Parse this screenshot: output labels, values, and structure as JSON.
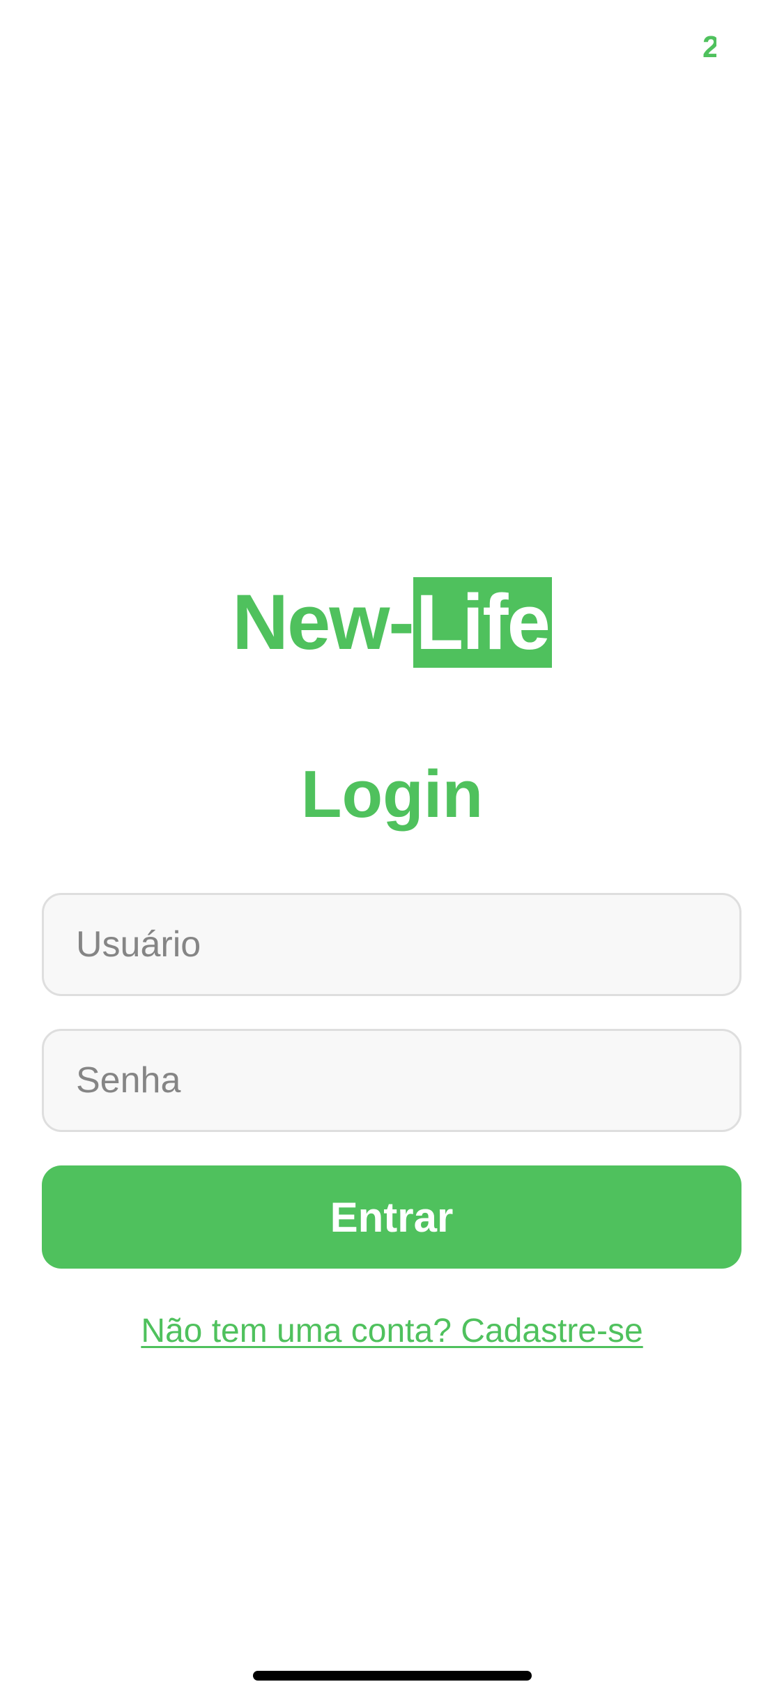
{
  "status_bar": {
    "glyph": "2"
  },
  "logo": {
    "part_a": "New-",
    "part_b": "Life"
  },
  "form": {
    "title": "Login",
    "username_placeholder": "Usuário",
    "username_value": "",
    "password_placeholder": "Senha",
    "password_value": "",
    "submit_label": "Entrar",
    "signup_link": "Não tem uma conta? Cadastre-se"
  },
  "colors": {
    "accent": "#4fc15d",
    "input_background": "#f8f8f8",
    "input_border": "#dedede",
    "placeholder_text": "#858585"
  }
}
